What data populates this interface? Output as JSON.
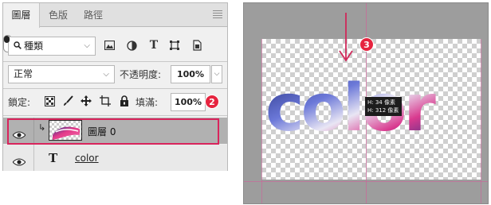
{
  "layers_panel": {
    "tabs": [
      {
        "label": "圖層",
        "active": true
      },
      {
        "label": "色版",
        "active": false
      },
      {
        "label": "路徑",
        "active": false
      }
    ],
    "menu_icon": "hamburger-icon",
    "filter": {
      "kind_label": "種類",
      "icons": [
        "image-filter-icon",
        "adjustment-filter-icon",
        "type-filter-icon",
        "shape-filter-icon",
        "smart-object-filter-icon",
        "filter-toggle"
      ]
    },
    "blend_mode": "正常",
    "opacity_label": "不透明度:",
    "opacity_value": "100%",
    "lock_label": "鎖定:",
    "lock_icons": [
      "lock-transparent-icon",
      "lock-paint-icon",
      "lock-position-icon",
      "lock-artboard-icon",
      "lock-all-icon"
    ],
    "fill_label": "填滿:",
    "fill_value": "100%",
    "callout_2": "2",
    "layers": [
      {
        "name": "圖層 0",
        "type": "image",
        "clipped": true,
        "selected": true,
        "visible": true
      },
      {
        "name": "color",
        "type": "text",
        "clipped": false,
        "selected": false,
        "visible": true
      }
    ]
  },
  "canvas": {
    "word": "color",
    "callout_3": "3",
    "measure_tip": {
      "line1": "H: 34 像素",
      "line2": "H: 312 像素"
    }
  },
  "colors": {
    "highlight": "#d9245c",
    "callout": "#e6243f",
    "selected_row": "#b1b1b1",
    "canvas_bg": "#9d9d9d",
    "guide": "#c86a9a"
  }
}
